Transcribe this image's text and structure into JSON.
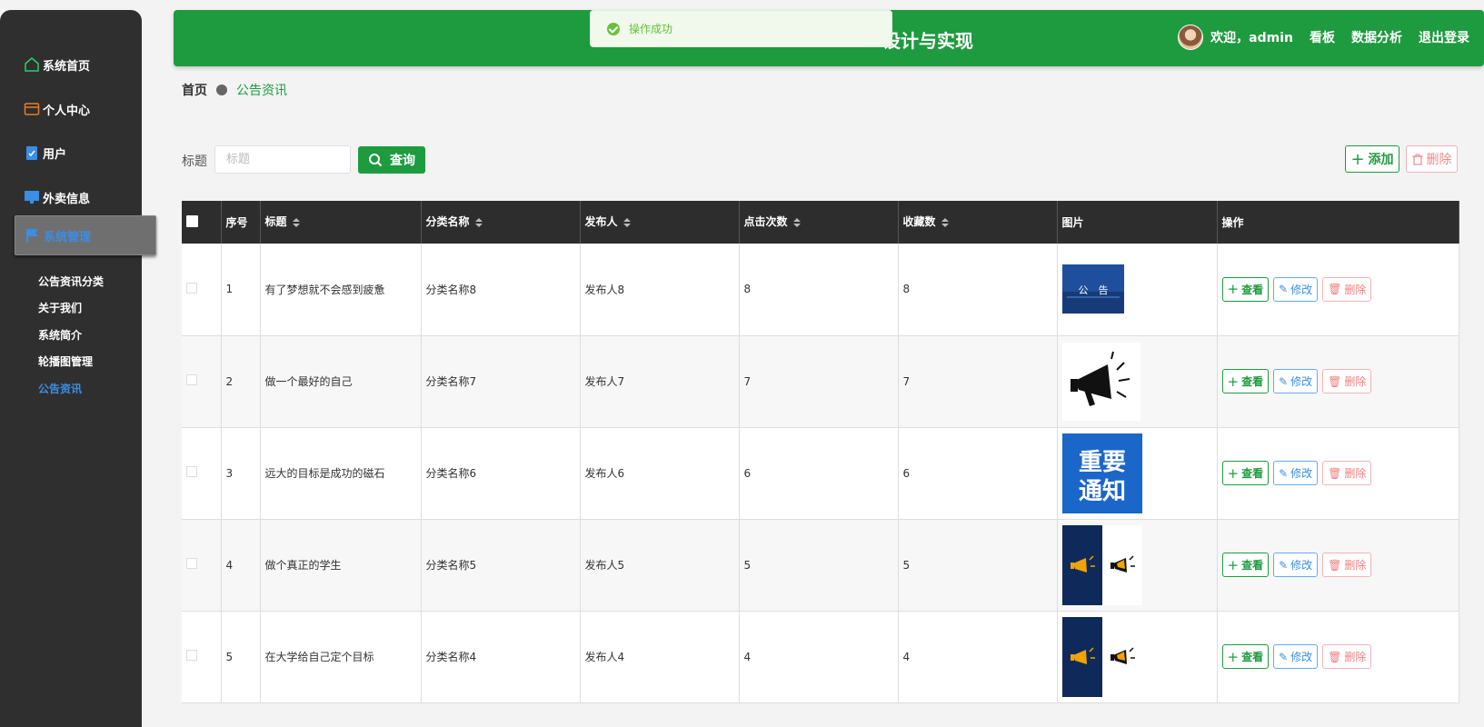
{
  "sidebar": {
    "items": [
      {
        "label": "系统首页",
        "icon": "home-icon"
      },
      {
        "label": "个人中心",
        "icon": "card-icon"
      },
      {
        "label": "用户",
        "icon": "clipboard-icon"
      },
      {
        "label": "外卖信息",
        "icon": "monitor-icon"
      },
      {
        "label": "系统管理",
        "icon": "flag-icon"
      }
    ],
    "submenu": [
      "公告资讯分类",
      "关于我们",
      "系统简介",
      "轮播图管理",
      "公告资讯"
    ]
  },
  "header": {
    "title": "设计与实现",
    "welcome": "欢迎，admin",
    "links": [
      "看板",
      "数据分析",
      "退出登录"
    ]
  },
  "toast": {
    "message": "操作成功"
  },
  "breadcrumb": {
    "home": "首页",
    "current": "公告资讯"
  },
  "search": {
    "label": "标题",
    "placeholder": "标题",
    "value": "",
    "button": "查询"
  },
  "actions": {
    "add": "添加",
    "delete": "删除"
  },
  "table": {
    "headers": [
      "序号",
      "标题",
      "分类名称",
      "发布人",
      "点击次数",
      "收藏数",
      "图片",
      "操作"
    ],
    "rows": [
      {
        "no": "1",
        "title": "有了梦想就不会感到疲惫",
        "category": "分类名称8",
        "publisher": "发布人8",
        "clicks": "8",
        "favorites": "8",
        "image": "notice-banner-image",
        "image_text": "公　告"
      },
      {
        "no": "2",
        "title": "做一个最好的自己",
        "category": "分类名称7",
        "publisher": "发布人7",
        "clicks": "7",
        "favorites": "7",
        "image": "megaphone-image",
        "image_text": ""
      },
      {
        "no": "3",
        "title": "远大的目标是成功的磁石",
        "category": "分类名称6",
        "publisher": "发布人6",
        "clicks": "6",
        "favorites": "6",
        "image": "important-notice-image",
        "image_text": "重要通知"
      },
      {
        "no": "4",
        "title": "做个真正的学生",
        "category": "分类名称5",
        "publisher": "发布人5",
        "clicks": "5",
        "favorites": "5",
        "image": "megaphone-pair-image",
        "image_text": ""
      },
      {
        "no": "5",
        "title": "在大学给自己定个目标",
        "category": "分类名称4",
        "publisher": "发布人4",
        "clicks": "4",
        "favorites": "4",
        "image": "megaphone-pair-image",
        "image_text": ""
      }
    ],
    "row_actions": {
      "view": "查看",
      "edit": "修改",
      "delete": "删除"
    }
  }
}
